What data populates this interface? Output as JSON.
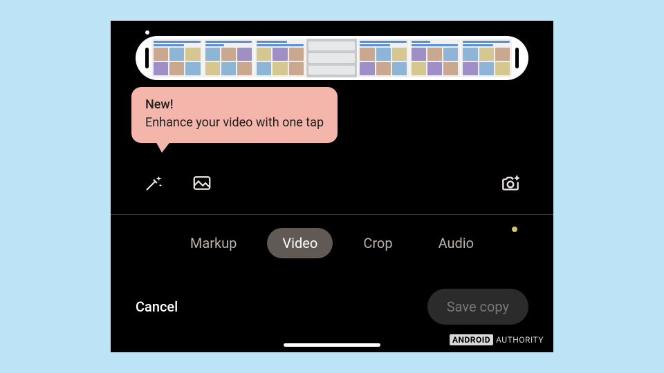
{
  "tooltip": {
    "title": "New!",
    "body": "Enhance your video with one tap"
  },
  "tabs": {
    "items": [
      "Markup",
      "Video",
      "Crop",
      "Audio"
    ],
    "active_index": 1
  },
  "actions": {
    "cancel": "Cancel",
    "save": "Save copy"
  },
  "watermark": {
    "brand": "ANDROID",
    "suffix": "AUTHORITY"
  },
  "icons": {
    "enhance": "magic-wand-icon",
    "frame": "frame-photo-icon",
    "export": "camera-plus-icon"
  }
}
